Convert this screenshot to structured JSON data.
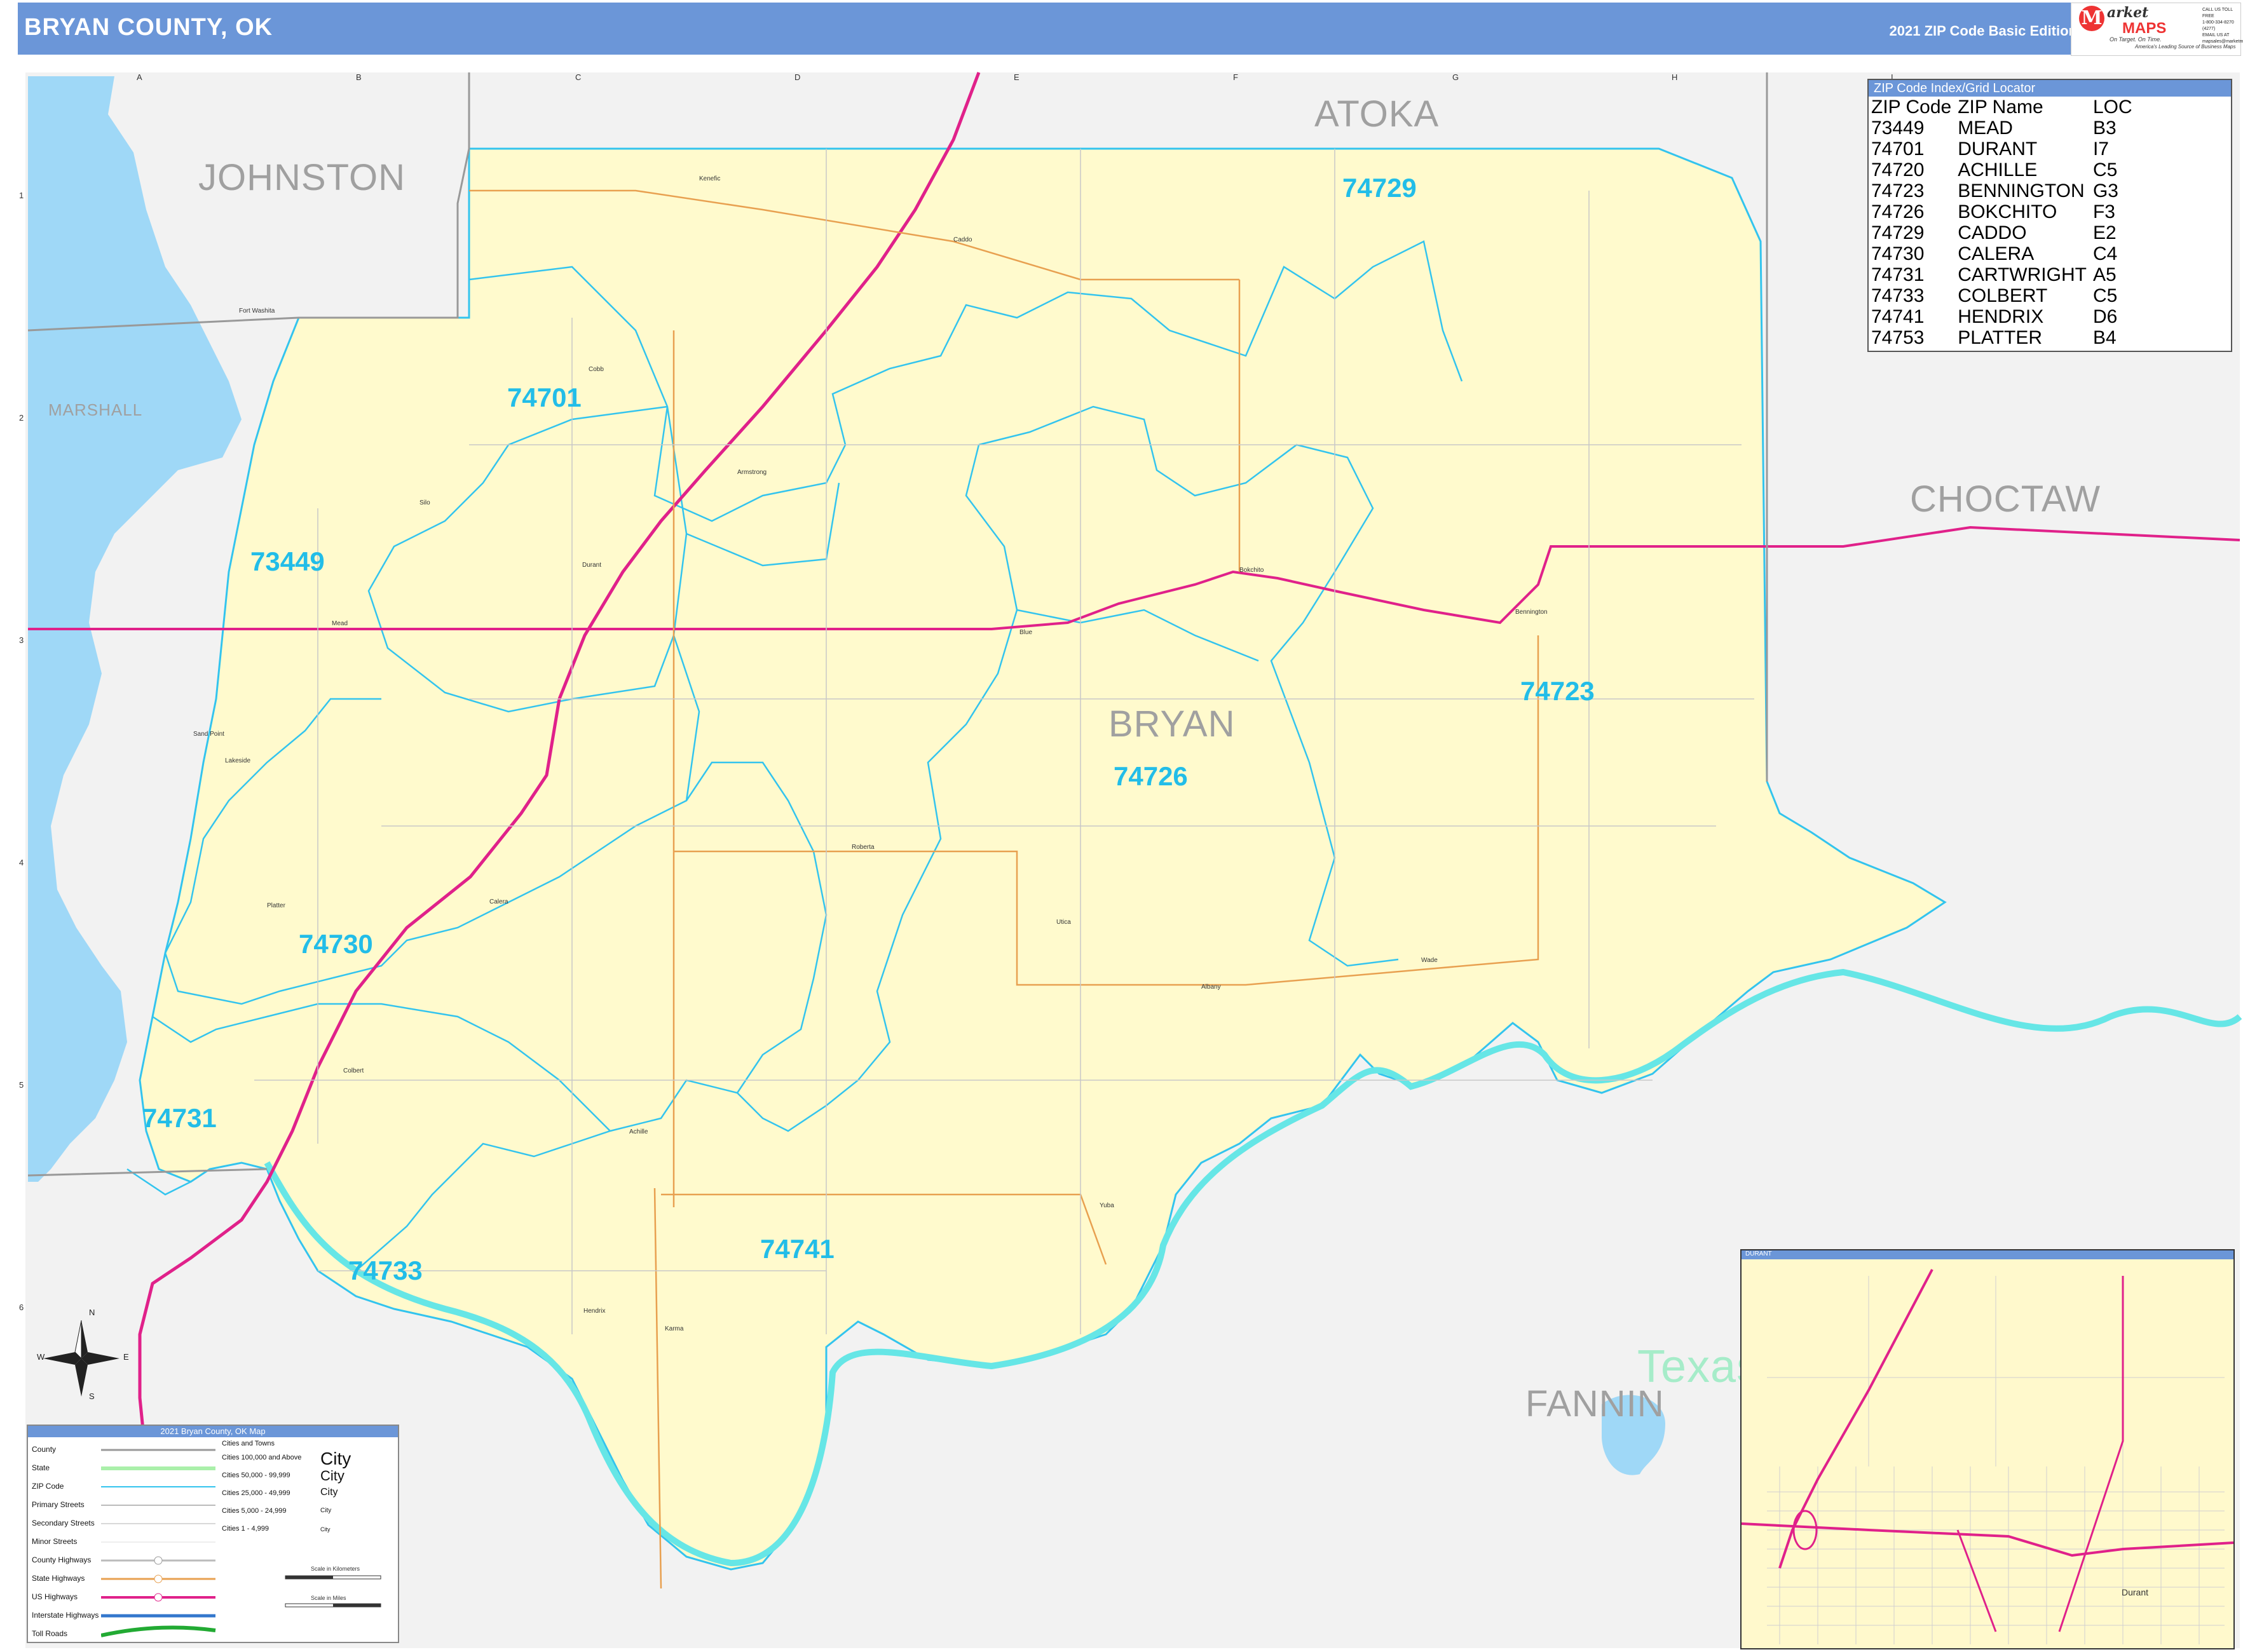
{
  "header": {
    "title": "BRYAN COUNTY, OK",
    "edition": "2021 ZIP Code Basic Edition"
  },
  "logo": {
    "mark": "M",
    "name1": "arket",
    "name2": "MAPS",
    "slogan1": "On Target. On Time.",
    "slogan2": "America's Leading Source of Business Maps",
    "contact": [
      "CALL US TOLL FREE",
      "1-800-334-8270 (4277)",
      "EMAIL US AT",
      "mapsales@marketmaps.com"
    ]
  },
  "grid": {
    "columns": [
      "A",
      "B",
      "C",
      "D",
      "E",
      "F",
      "G",
      "H",
      "I"
    ],
    "rows": [
      "1",
      "2",
      "3",
      "4",
      "5",
      "6"
    ]
  },
  "counties": {
    "johnston": "JOHNSTON",
    "atoka": "ATOKA",
    "choctaw": "CHOCTAW",
    "marshall": "MARSHALL",
    "bryan": "BRYAN",
    "fannin": "FANNIN",
    "texas": "Texas"
  },
  "zip_labels": [
    "74729",
    "74701",
    "73449",
    "74723",
    "74726",
    "74730",
    "74731",
    "74741",
    "74733"
  ],
  "places": {
    "fort_washita": "Fort Washita",
    "caddo": "Caddo",
    "kenefic": "Kenefic",
    "cobb": "Cobb",
    "armstrong": "Armstrong",
    "silo": "Silo",
    "mead": "Mead",
    "durant": "Durant",
    "bokchito": "Bokchito",
    "bennington": "Bennington",
    "blue": "Blue",
    "sand_point": "Sand Point",
    "lakeside": "Lakeside",
    "roberta": "Roberta",
    "platter": "Platter",
    "utica": "Utica",
    "albany": "Albany",
    "wade": "Wade",
    "calera": "Calera",
    "colbert": "Colbert",
    "achille": "Achille",
    "yuba": "Yuba",
    "hendrix": "Hendrix",
    "karma": "Karma"
  },
  "zip_index": {
    "title": "ZIP Code Index/Grid Locator",
    "headers": [
      "ZIP Code",
      "ZIP Name",
      "LOC"
    ],
    "rows": [
      [
        "73449",
        "MEAD",
        "B3"
      ],
      [
        "74701",
        "DURANT",
        "I7"
      ],
      [
        "74720",
        "ACHILLE",
        "C5"
      ],
      [
        "74723",
        "BENNINGTON",
        "G3"
      ],
      [
        "74726",
        "BOKCHITO",
        "F3"
      ],
      [
        "74729",
        "CADDO",
        "E2"
      ],
      [
        "74730",
        "CALERA",
        "C4"
      ],
      [
        "74731",
        "CARTWRIGHT",
        "A5"
      ],
      [
        "74733",
        "COLBERT",
        "C5"
      ],
      [
        "74741",
        "HENDRIX",
        "D6"
      ],
      [
        "74753",
        "PLATTER",
        "B4"
      ]
    ]
  },
  "inset": {
    "title": "DURANT",
    "place": "Durant"
  },
  "compass": {
    "n": "N",
    "s": "S",
    "e": "E",
    "w": "W"
  },
  "legend": {
    "title": "2021 Bryan County, OK Map",
    "rows": [
      "County",
      "State",
      "ZIP Code",
      "Primary Streets",
      "Secondary Streets",
      "Minor Streets",
      "County Highways",
      "State Highways",
      "US Highways",
      "Interstate Highways",
      "Toll Roads"
    ],
    "colors": [
      "#999999",
      "#aaf0aa",
      "#33c4ee",
      "#bbbbbb",
      "#cccccc",
      "#dddddd",
      "#bbbbbb",
      "#e8a050",
      "#e0218a",
      "#3377cc",
      "#22aa33"
    ],
    "cities_title": "Cities and Towns",
    "cities": [
      "Cities 100,000 and Above",
      "Cities 50,000 - 99,999",
      "Cities 25,000 - 49,999",
      "Cities 5,000 - 24,999",
      "Cities 1 - 4,999"
    ],
    "city_sample": "City",
    "scale_km": "Scale in Kilometers",
    "scale_mi": "Scale in Miles"
  },
  "colors": {
    "header": "#6b96d8",
    "county_fill": "#fffacd",
    "water": "#9fd8f7",
    "zip_boundary": "#33c4ee",
    "us_highway": "#e0218a",
    "state_highway": "#e8a050",
    "outside": "#f2f2f2"
  }
}
